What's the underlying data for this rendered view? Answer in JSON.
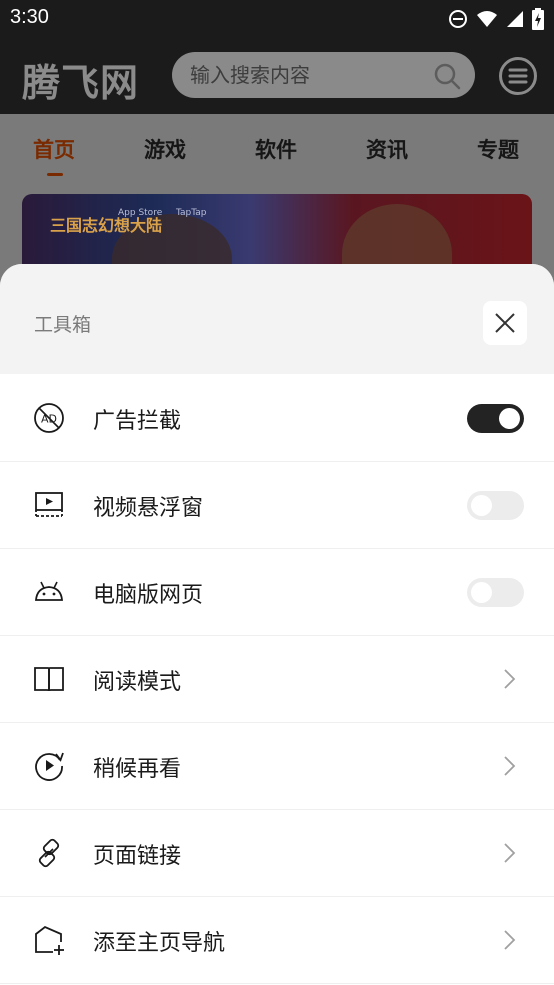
{
  "status_bar": {
    "time": "3:30",
    "icons": [
      "do-not-disturb-icon",
      "wifi-icon",
      "signal-icon",
      "battery-charging-icon"
    ]
  },
  "header": {
    "logo": "腾飞网",
    "search_placeholder": "输入搜索内容",
    "search_icon": "search-icon",
    "menu_icon": "menu-icon"
  },
  "nav": {
    "tabs": [
      {
        "label": "首页",
        "active": true
      },
      {
        "label": "游戏",
        "active": false
      },
      {
        "label": "软件",
        "active": false
      },
      {
        "label": "资讯",
        "active": false
      },
      {
        "label": "专题",
        "active": false
      }
    ]
  },
  "banner": {
    "logo_text": "三国志幻想大陆",
    "store_a": "App Store",
    "store_b": "TapTap"
  },
  "toolbox": {
    "title": "工具箱",
    "close_icon": "close-icon",
    "items": [
      {
        "label": "广告拦截",
        "icon": "ad-block-icon",
        "control": "toggle",
        "on": true
      },
      {
        "label": "视频悬浮窗",
        "icon": "video-float-icon",
        "control": "toggle",
        "on": false
      },
      {
        "label": "电脑版网页",
        "icon": "android-icon",
        "control": "toggle",
        "on": false
      },
      {
        "label": "阅读模式",
        "icon": "book-icon",
        "control": "chevron"
      },
      {
        "label": "稍候再看",
        "icon": "watch-later-icon",
        "control": "chevron"
      },
      {
        "label": "页面链接",
        "icon": "link-icon",
        "control": "chevron"
      },
      {
        "label": "添至主页导航",
        "icon": "add-home-icon",
        "control": "chevron"
      }
    ]
  }
}
